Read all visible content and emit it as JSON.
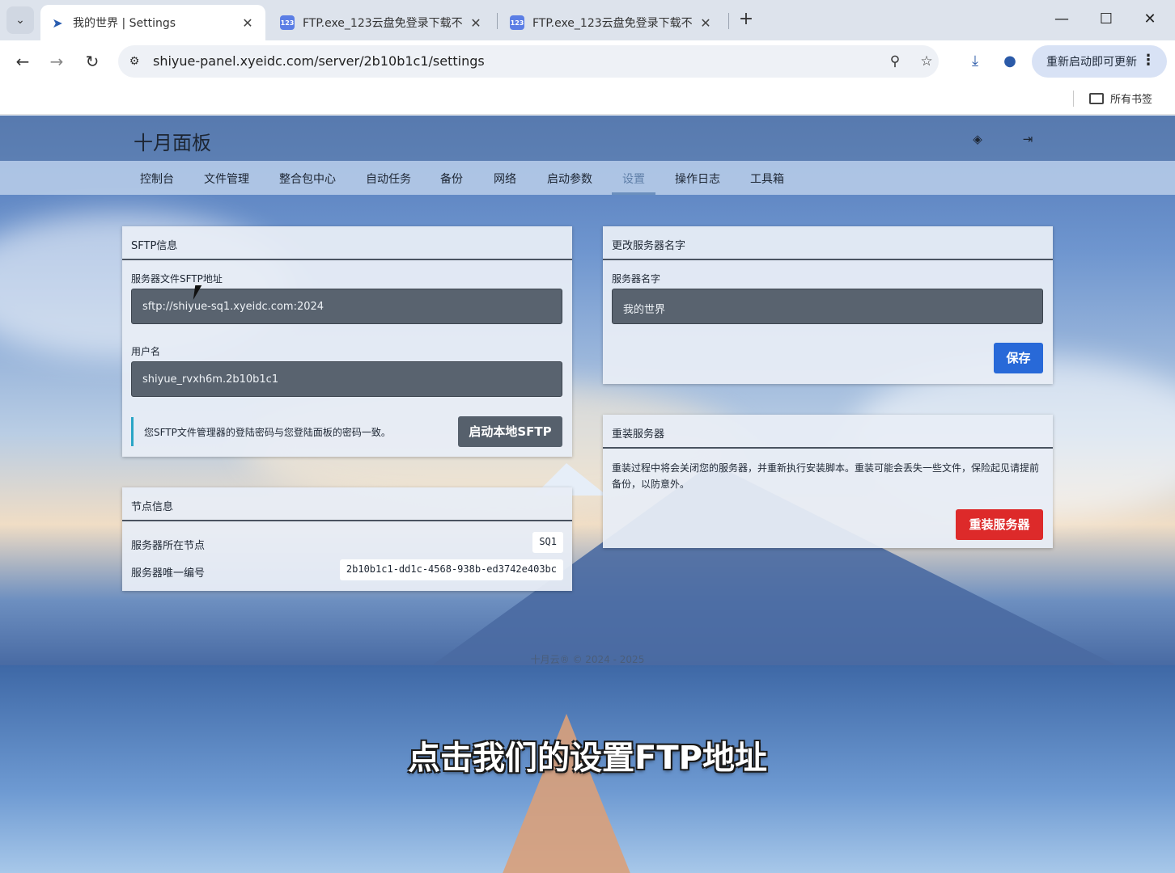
{
  "browser": {
    "tabs": [
      {
        "title": "我的世界 | Settings",
        "icon": "bird-icon"
      },
      {
        "title": "FTP.exe_123云盘免登录下载不",
        "icon": "123pan-icon"
      },
      {
        "title": "FTP.exe_123云盘免登录下载不",
        "icon": "123pan-icon"
      }
    ],
    "tab_close": "✕",
    "new_tab": "+",
    "url": "shiyue-panel.xyeidc.com/server/2b10b1c1/settings",
    "update_label": "重新启动即可更新",
    "bookmarks_label": "所有书签"
  },
  "panel": {
    "title": "十月面板",
    "nav": [
      "控制台",
      "文件管理",
      "整合包中心",
      "自动任务",
      "备份",
      "网络",
      "启动参数",
      "设置",
      "操作日志",
      "工具箱"
    ],
    "active_nav": "设置"
  },
  "sftp": {
    "header": "SFTP信息",
    "address_label": "服务器文件SFTP地址",
    "address_value": "sftp://shiyue-sq1.xyeidc.com:2024",
    "username_label": "用户名",
    "username_value": "shiyue_rvxh6m.2b10b1c1",
    "info": "您SFTP文件管理器的登陆密码与您登陆面板的密码一致。",
    "button": "启动本地SFTP"
  },
  "node": {
    "header": "节点信息",
    "node_label": "服务器所在节点",
    "node_value": "SQ1",
    "id_label": "服务器唯一编号",
    "id_value": "2b10b1c1-dd1c-4568-938b-ed3742e403bc"
  },
  "rename": {
    "header": "更改服务器名字",
    "name_label": "服务器名字",
    "name_value": "我的世界",
    "save_button": "保存"
  },
  "reinstall": {
    "header": "重装服务器",
    "description": "重装过程中将会关闭您的服务器，并重新执行安装脚本。重装可能会丢失一些文件，保险起见请提前备份，以防意外。",
    "button": "重装服务器"
  },
  "footer": "十月云® © 2024 - 2025",
  "subtitle": "点击我们的设置FTP地址",
  "colors": {
    "accent": "#2869d8",
    "danger": "#dd2a2a",
    "info_bar": "#2aa5c6"
  }
}
